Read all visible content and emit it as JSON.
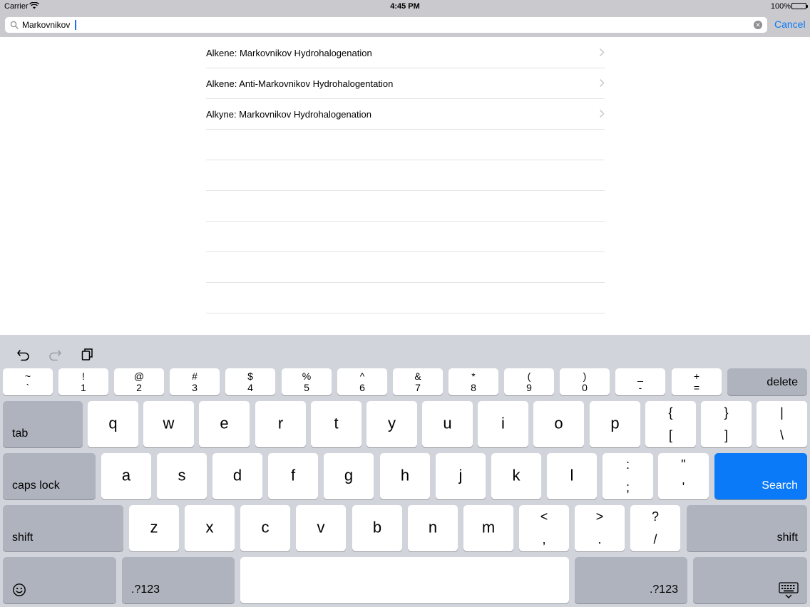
{
  "status": {
    "carrier": "Carrier",
    "time": "4:45 PM",
    "battery": "100%"
  },
  "search": {
    "value": "Markovnikov",
    "cancel_label": "Cancel"
  },
  "results": [
    "Alkene: Markovnikov Hydrohalogenation",
    "Alkene: Anti-Markovnikov Hydrohalogentation",
    "Alkyne: Markovnikov Hydrohalogenation"
  ],
  "colors": {
    "accent": "#0b7af8",
    "keyboard_bg": "#d1d5db",
    "special_key": "#aeb3bd"
  },
  "keyboard": {
    "num_row": [
      {
        "top": "~",
        "bottom": "`"
      },
      {
        "top": "!",
        "bottom": "1"
      },
      {
        "top": "@",
        "bottom": "2"
      },
      {
        "top": "#",
        "bottom": "3"
      },
      {
        "top": "$",
        "bottom": "4"
      },
      {
        "top": "%",
        "bottom": "5"
      },
      {
        "top": "^",
        "bottom": "6"
      },
      {
        "top": "&",
        "bottom": "7"
      },
      {
        "top": "*",
        "bottom": "8"
      },
      {
        "top": "(",
        "bottom": "9"
      },
      {
        "top": ")",
        "bottom": "0"
      },
      {
        "top": "_",
        "bottom": "-"
      },
      {
        "top": "+",
        "bottom": "="
      }
    ],
    "delete": "delete",
    "tab": "tab",
    "row_q": [
      "q",
      "w",
      "e",
      "r",
      "t",
      "y",
      "u",
      "i",
      "o",
      "p"
    ],
    "row_q_sym": [
      {
        "top": "{",
        "bottom": "["
      },
      {
        "top": "}",
        "bottom": "]"
      },
      {
        "top": "|",
        "bottom": "\\"
      }
    ],
    "caps": "caps lock",
    "row_a": [
      "a",
      "s",
      "d",
      "f",
      "g",
      "h",
      "j",
      "k",
      "l"
    ],
    "row_a_sym": [
      {
        "top": ":",
        "bottom": ";"
      },
      {
        "top": "\"",
        "bottom": "'"
      }
    ],
    "search": "Search",
    "shift": "shift",
    "row_z": [
      "z",
      "x",
      "c",
      "v",
      "b",
      "n",
      "m"
    ],
    "row_z_sym": [
      {
        "top": "<",
        "bottom": ","
      },
      {
        "top": ">",
        "bottom": "."
      },
      {
        "top": "?",
        "bottom": "/"
      }
    ],
    "num_label": ".?123"
  }
}
